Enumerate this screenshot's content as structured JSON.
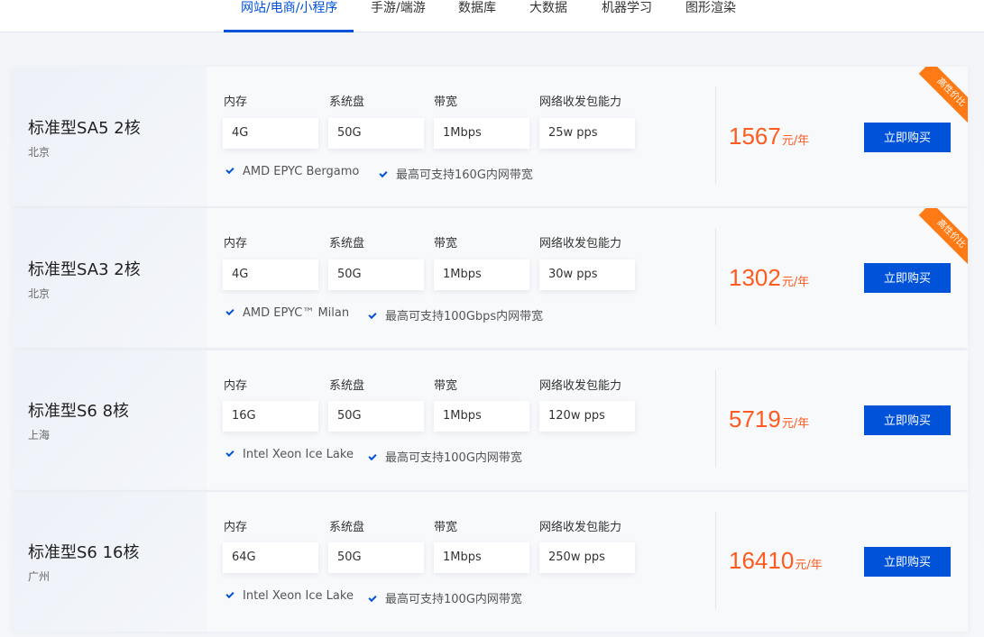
{
  "tabs": [
    {
      "label": "网站/电商/小程序",
      "active": true
    },
    {
      "label": "手游/端游",
      "active": false
    },
    {
      "label": "数据库",
      "active": false
    },
    {
      "label": "大数据",
      "active": false
    },
    {
      "label": "机器学习",
      "active": false
    },
    {
      "label": "图形渲染",
      "active": false
    }
  ],
  "spec_labels": {
    "memory": "内存",
    "disk": "系统盘",
    "bandwidth": "带宽",
    "pps": "网络收发包能力"
  },
  "products": [
    {
      "name": "标准型SA5 2核",
      "region": "北京",
      "memory": "4G",
      "disk": "50G",
      "bandwidth": "1Mbps",
      "pps": "25w pps",
      "feature1": "AMD EPYC Bergamo",
      "feature2": "最高可支持160G内网带宽",
      "price": "1567",
      "unit": "元/年",
      "buy_label": "立即购买",
      "badge": "高性价比"
    },
    {
      "name": "标准型SA3 2核",
      "region": "北京",
      "memory": "4G",
      "disk": "50G",
      "bandwidth": "1Mbps",
      "pps": "30w pps",
      "feature1": "AMD EPYC™ Milan",
      "feature2": "最高可支持100Gbps内网带宽",
      "price": "1302",
      "unit": "元/年",
      "buy_label": "立即购买",
      "badge": "高性价比"
    },
    {
      "name": "标准型S6 8核",
      "region": "上海",
      "memory": "16G",
      "disk": "50G",
      "bandwidth": "1Mbps",
      "pps": "120w pps",
      "feature1": "Intel Xeon Ice Lake",
      "feature2": "最高可支持100G内网带宽",
      "price": "5719",
      "unit": "元/年",
      "buy_label": "立即购买",
      "badge": ""
    },
    {
      "name": "标准型S6 16核",
      "region": "广州",
      "memory": "64G",
      "disk": "50G",
      "bandwidth": "1Mbps",
      "pps": "250w pps",
      "feature1": "Intel Xeon Ice Lake",
      "feature2": "最高可支持100G内网带宽",
      "price": "16410",
      "unit": "元/年",
      "buy_label": "立即购买",
      "badge": ""
    }
  ],
  "colors": {
    "accent": "#0052d9",
    "price": "#ff5a1f",
    "badge": "#ff7a14"
  }
}
